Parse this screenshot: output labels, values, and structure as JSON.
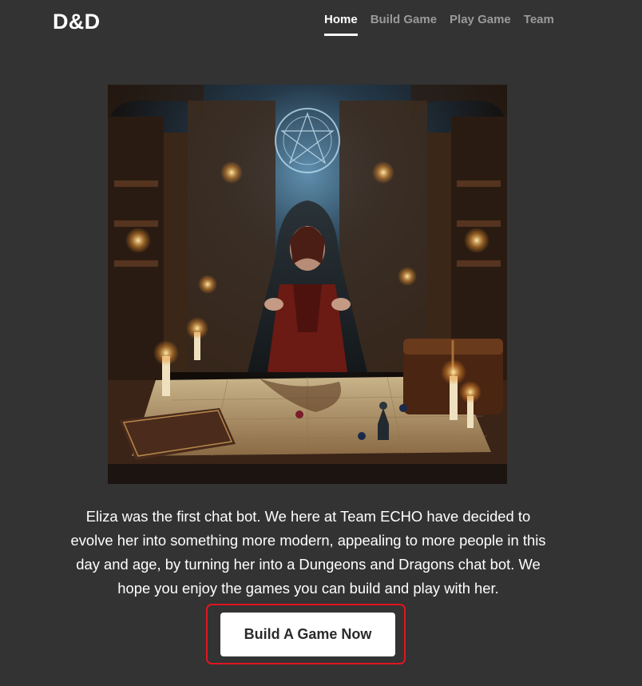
{
  "header": {
    "brand": "D&D",
    "nav": [
      {
        "label": "Home",
        "active": true
      },
      {
        "label": "Build Game",
        "active": false
      },
      {
        "label": "Play Game",
        "active": false
      },
      {
        "label": "Team",
        "active": false
      }
    ]
  },
  "hero": {
    "icon": "dungeon-master-illustration"
  },
  "main": {
    "intro_text": "Eliza was the first chat bot. We here at Team ECHO have decided to evolve her into something more modern, appealing to more people in this day and age, by turning her into a Dungeons and Dragons chat bot. We hope you enjoy the games you can build and play with her.",
    "cta_label": "Build A Game Now"
  },
  "colors": {
    "background": "#333333",
    "nav_inactive": "#9a9a9a",
    "highlight_outline": "#e01522"
  }
}
